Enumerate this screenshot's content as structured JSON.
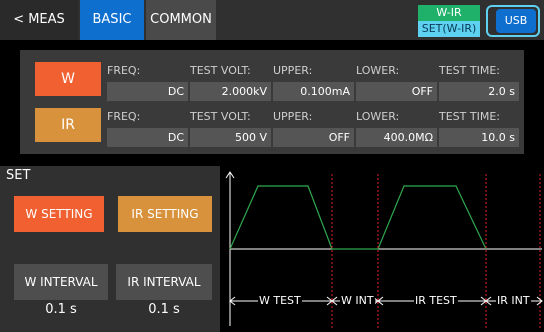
{
  "header": {
    "tabs": [
      {
        "label": "< MEAS"
      },
      {
        "label": "BASIC"
      },
      {
        "label": "COMMON"
      }
    ],
    "mode_top": "W-IR",
    "mode_bottom": "SET(W-IR)",
    "usb_label": "USB"
  },
  "config": {
    "w": {
      "name": "W",
      "fields": [
        {
          "label": "FREQ:",
          "value": "DC"
        },
        {
          "label": "TEST VOLT:",
          "value": "2.000kV"
        },
        {
          "label": "UPPER:",
          "value": "0.100mA"
        },
        {
          "label": "LOWER:",
          "value": "OFF"
        },
        {
          "label": "TEST TIME:",
          "value": "2.0 s"
        }
      ]
    },
    "ir": {
      "name": "IR",
      "fields": [
        {
          "label": "FREQ:",
          "value": "DC"
        },
        {
          "label": "TEST VOLT:",
          "value": "500 V"
        },
        {
          "label": "UPPER:",
          "value": "OFF"
        },
        {
          "label": "LOWER:",
          "value": "400.0MΩ"
        },
        {
          "label": "TEST TIME:",
          "value": "10.0 s"
        }
      ]
    }
  },
  "set_panel": {
    "title": "SET",
    "w_setting": "W SETTING",
    "ir_setting": "IR SETTING",
    "w_interval": "W INTERVAL",
    "ir_interval": "IR INTERVAL",
    "w_interval_value": "0.1 s",
    "ir_interval_value": "0.1 s"
  },
  "waveform": {
    "labels": [
      "W TEST",
      "W INT",
      "IR TEST",
      "IR INT"
    ],
    "colors": {
      "wave": "#2fa84f",
      "marker": "#e02020",
      "baseline": "#ffffff"
    }
  }
}
